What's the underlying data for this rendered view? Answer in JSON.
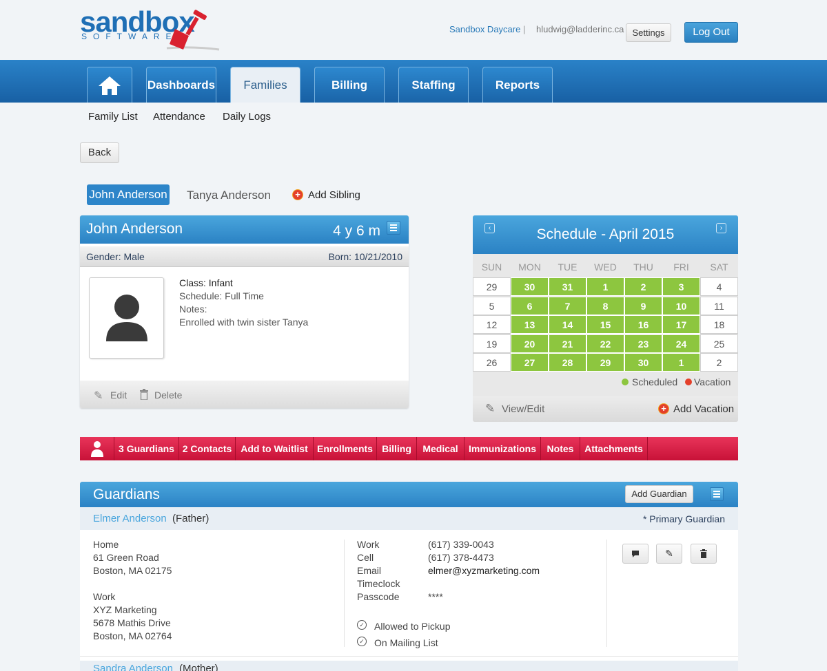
{
  "header": {
    "logo_main": "sandbox",
    "logo_sub": "SOFTWARE",
    "org_link": "Sandbox Daycare",
    "separator": "|",
    "user_email": "hludwig@ladderinc.ca",
    "settings_label": "Settings",
    "logout_label": "Log Out"
  },
  "nav": {
    "tabs": [
      {
        "label": "Dashboards"
      },
      {
        "label": "Families"
      },
      {
        "label": "Billing"
      },
      {
        "label": "Staffing"
      },
      {
        "label": "Reports"
      }
    ],
    "active": "Families"
  },
  "subnav": [
    "Family List",
    "Attendance",
    "Daily Logs"
  ],
  "back_label": "Back",
  "siblings": {
    "active": "John Anderson",
    "other": "Tanya Anderson",
    "add_label": "Add Sibling"
  },
  "child": {
    "name": "John Anderson",
    "age": "4 y 6 m",
    "gender": "Gender: Male",
    "born": "Born: 10/21/2010",
    "class": "Class: Infant",
    "schedule": "Schedule: Full Time",
    "notes_label": "Notes:",
    "notes": "Enrolled with twin sister Tanya",
    "edit_label": "Edit",
    "delete_label": "Delete"
  },
  "schedule": {
    "title": "Schedule - April 2015",
    "days": [
      "SUN",
      "MON",
      "TUE",
      "WED",
      "THU",
      "FRI",
      "SAT"
    ],
    "weeks": [
      [
        {
          "d": "29",
          "s": false
        },
        {
          "d": "30",
          "s": true
        },
        {
          "d": "31",
          "s": true
        },
        {
          "d": "1",
          "s": true
        },
        {
          "d": "2",
          "s": true
        },
        {
          "d": "3",
          "s": true
        },
        {
          "d": "4",
          "s": false
        }
      ],
      [
        {
          "d": "5",
          "s": false
        },
        {
          "d": "6",
          "s": true
        },
        {
          "d": "7",
          "s": true
        },
        {
          "d": "8",
          "s": true
        },
        {
          "d": "9",
          "s": true
        },
        {
          "d": "10",
          "s": true
        },
        {
          "d": "11",
          "s": false
        }
      ],
      [
        {
          "d": "12",
          "s": false
        },
        {
          "d": "13",
          "s": true
        },
        {
          "d": "14",
          "s": true
        },
        {
          "d": "15",
          "s": true
        },
        {
          "d": "16",
          "s": true
        },
        {
          "d": "17",
          "s": true
        },
        {
          "d": "18",
          "s": false
        }
      ],
      [
        {
          "d": "19",
          "s": false
        },
        {
          "d": "20",
          "s": true
        },
        {
          "d": "21",
          "s": true
        },
        {
          "d": "22",
          "s": true
        },
        {
          "d": "23",
          "s": true
        },
        {
          "d": "24",
          "s": true
        },
        {
          "d": "25",
          "s": false
        }
      ],
      [
        {
          "d": "26",
          "s": false
        },
        {
          "d": "27",
          "s": true
        },
        {
          "d": "28",
          "s": true
        },
        {
          "d": "29",
          "s": true
        },
        {
          "d": "30",
          "s": true
        },
        {
          "d": "1",
          "s": true
        },
        {
          "d": "2",
          "s": false
        }
      ]
    ],
    "legend_scheduled": "Scheduled",
    "legend_vacation": "Vacation",
    "scheduled_color": "#8dc63f",
    "vacation_color": "#e4402a",
    "view_edit_label": "View/Edit",
    "add_vacation_label": "Add Vacation"
  },
  "tabs_bar": [
    "3 Guardians",
    "2 Contacts",
    "Add to Waitlist",
    "Enrollments",
    "Billing",
    "Medical",
    "Immunizations",
    "Notes",
    "Attachments"
  ],
  "guardians": {
    "title": "Guardians",
    "add_label": "Add Guardian",
    "primary": {
      "name": "Elmer Anderson",
      "relation": "(Father)",
      "primary_note": "* Primary Guardian",
      "home_label": "Home",
      "home_line1": "61 Green Road",
      "home_line2": "Boston, MA 02175",
      "work_label": "Work",
      "work_line1": "XYZ Marketing",
      "work_line2": "5678 Mathis Drive",
      "work_line3": "Boston, MA 02764",
      "contacts": [
        {
          "label": "Work",
          "value": "(617) 339-0043"
        },
        {
          "label": "Cell",
          "value": "(617) 378-4473"
        },
        {
          "label": "Email",
          "value": "elmer@xyzmarketing.com"
        },
        {
          "label": "Timeclock",
          "value": ""
        },
        {
          "label": "Passcode",
          "value": "****"
        }
      ],
      "allowed_pickup": "Allowed to Pickup",
      "mailing_list": "On Mailing List"
    },
    "next": {
      "name": "Sandra Anderson",
      "relation": "(Mother)"
    }
  }
}
